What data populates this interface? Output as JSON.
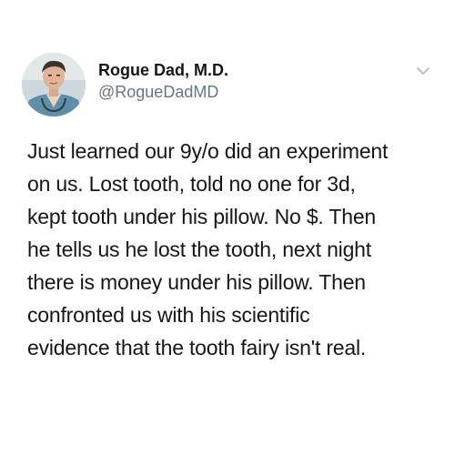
{
  "author": {
    "display_name": "Rogue Dad, M.D.",
    "handle": "@RogueDadMD",
    "avatar_icon": "profile-photo",
    "menu_icon": "chevron-down-icon"
  },
  "tweet": {
    "lines": [
      "Just learned our 9y/o did an experiment",
      "on us.  Lost tooth, told no one for 3d,",
      "kept tooth under his pillow.  No $.  Then",
      "he tells us he lost the tooth, next night",
      "there is money under his pillow.  Then",
      "confronted us with his scientific",
      "evidence that the tooth fairy isn't real."
    ]
  },
  "colors": {
    "text": "#14171a",
    "secondary": "#657786",
    "background": "#ffffff"
  }
}
